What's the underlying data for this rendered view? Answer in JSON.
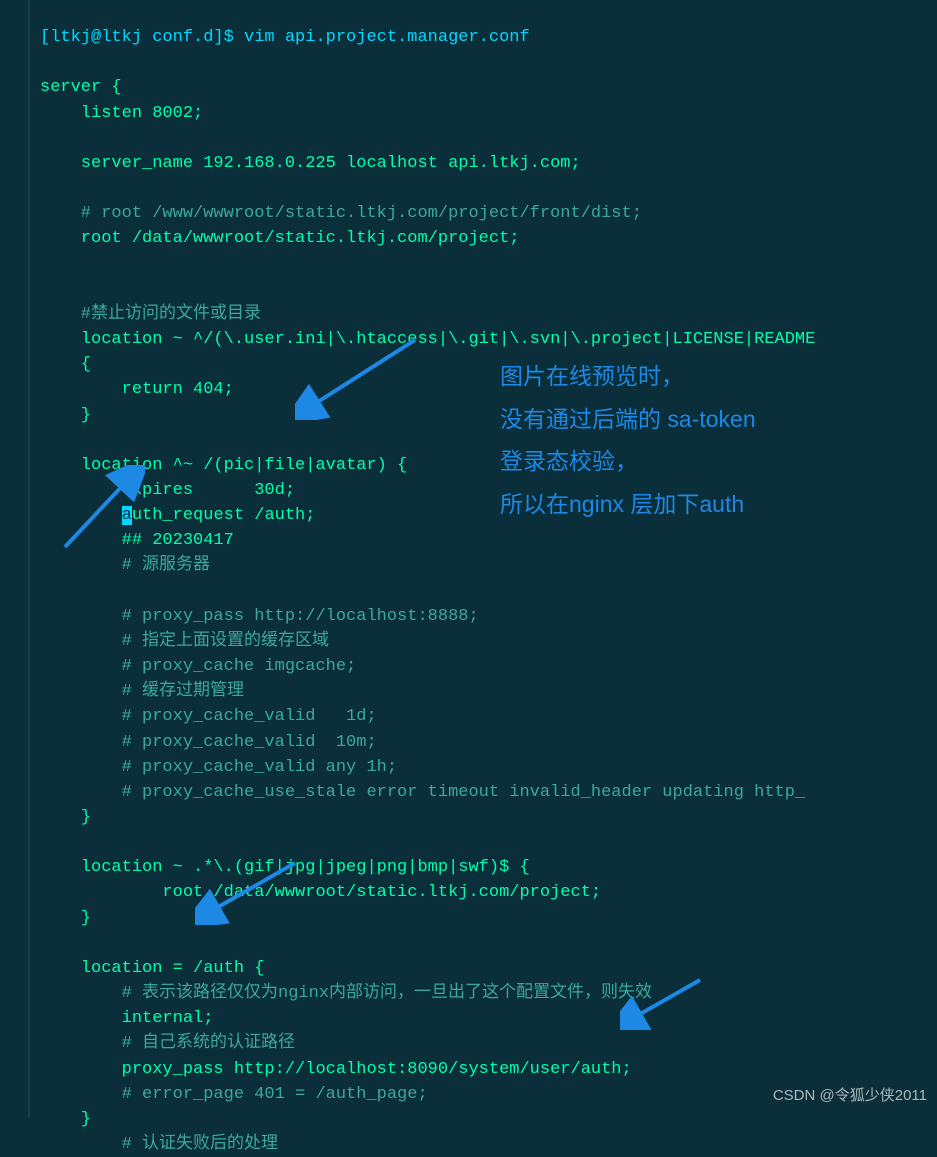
{
  "prompt": "[ltkj@ltkj conf.d]$ vim api.project.manager.conf",
  "lines": {
    "l1": "server {",
    "l2": "    listen 8002;",
    "l3": "    server_name 192.168.0.225 localhost api.ltkj.com;",
    "l4": "    # root /www/wwwroot/static.ltkj.com/project/front/dist;",
    "l5": "    root /data/wwwroot/static.ltkj.com/project;",
    "l6": "    #禁止访问的文件或目录",
    "l7": "    location ~ ^/(\\.user.ini|\\.htaccess|\\.git|\\.svn|\\.project|LICENSE|README",
    "l8": "    {",
    "l9": "        return 404;",
    "l10": "    }",
    "l11": "    location ^~ /(pic|file|avatar) {",
    "l12": "        expires      30d;",
    "l13a": "        ",
    "l13_cursor": "a",
    "l13b": "uth_request /auth;",
    "l14": "        ## 20230417",
    "l15": "        # 源服务器",
    "l16": "        # proxy_pass http://localhost:8888;",
    "l17": "        # 指定上面设置的缓存区域",
    "l18": "        # proxy_cache imgcache;",
    "l19": "        # 缓存过期管理",
    "l20": "        # proxy_cache_valid   1d;",
    "l21": "        # proxy_cache_valid  10m;",
    "l22": "        # proxy_cache_valid any 1h;",
    "l23": "        # proxy_cache_use_stale error timeout invalid_header updating http_",
    "l24": "    }",
    "l25": "    location ~ .*\\.(gif|jpg|jpeg|png|bmp|swf)$ {",
    "l26": "            root /data/wwwroot/static.ltkj.com/project;",
    "l27": "    }",
    "l28": "    location = /auth {",
    "l29": "        # 表示该路径仅仅为nginx内部访问，一旦出了这个配置文件，则失效",
    "l30": "        internal;",
    "l31": "        # 自己系统的认证路径",
    "l32": "        proxy_pass http://localhost:8090/system/user/auth;",
    "l33": "        # error_page 401 = /auth_page;",
    "l34": "    }",
    "l35": "        # 认证失败后的处理"
  },
  "annotation": {
    "line1": "图片在线预览时，",
    "line2": "没有通过后端的 sa-token",
    "line3": "登录态校验，",
    "line4": "所以在nginx 层加下auth"
  },
  "watermark": "CSDN @令狐少侠2011"
}
